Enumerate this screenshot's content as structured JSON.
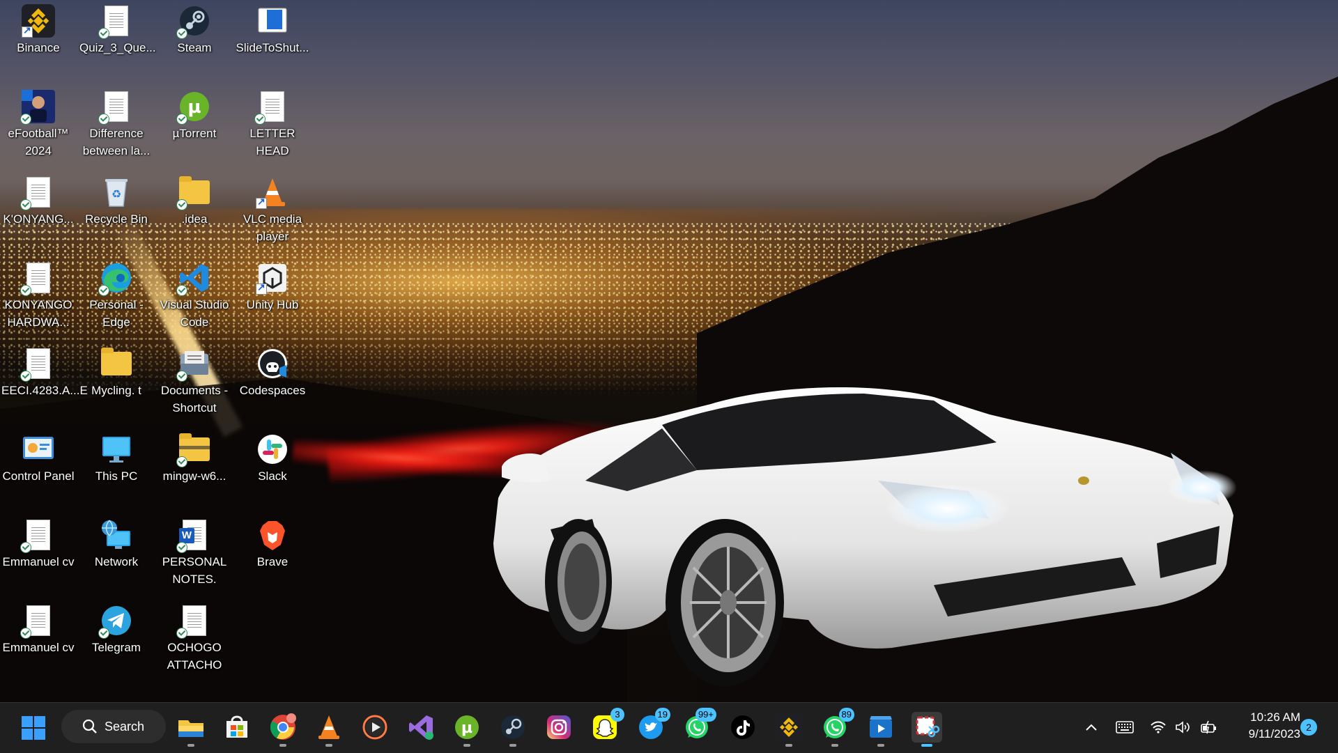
{
  "desktop": {
    "icons": [
      {
        "label": "Binance",
        "icon": "binance-icon"
      },
      {
        "label": "Quiz_3_Que...",
        "icon": "document-icon"
      },
      {
        "label": "Steam",
        "icon": "steam-icon"
      },
      {
        "label": "SlideToShut...",
        "icon": "slidetoshutdown-icon"
      },
      {
        "label": "eFootball™ 2024",
        "icon": "efootball-icon"
      },
      {
        "label": "Difference between la...",
        "icon": "document-icon"
      },
      {
        "label": "µTorrent",
        "icon": "utorrent-icon"
      },
      {
        "label": "LETTER HEAD",
        "icon": "document-icon"
      },
      {
        "label": "K'ONYANG...",
        "icon": "document-icon"
      },
      {
        "label": "Recycle Bin",
        "icon": "recycle-bin-icon"
      },
      {
        "label": ".idea",
        "icon": "folder-icon"
      },
      {
        "label": "VLC media player",
        "icon": "vlc-icon"
      },
      {
        "label": "KONYANGO HARDWA...",
        "icon": "document-icon"
      },
      {
        "label": "Personal - Edge",
        "icon": "edge-icon"
      },
      {
        "label": "Visual Studio Code",
        "icon": "vscode-icon"
      },
      {
        "label": "Unity Hub",
        "icon": "unity-hub-icon"
      },
      {
        "label": "EECI.4283.A...E",
        "icon": "document-icon"
      },
      {
        "label": "Mycling. t",
        "icon": "folder-icon"
      },
      {
        "label": "Documents - Shortcut",
        "icon": "documents-shortcut-icon"
      },
      {
        "label": "Codespaces",
        "icon": "codespaces-icon"
      },
      {
        "label": "Control Panel",
        "icon": "control-panel-icon"
      },
      {
        "label": "This PC",
        "icon": "this-pc-icon"
      },
      {
        "label": "mingw-w6...",
        "icon": "zip-folder-icon"
      },
      {
        "label": "Slack",
        "icon": "slack-icon"
      },
      {
        "label": "Emmanuel cv",
        "icon": "document-icon"
      },
      {
        "label": "Network",
        "icon": "network-icon"
      },
      {
        "label": "PERSONAL NOTES.",
        "icon": "word-document-icon"
      },
      {
        "label": "Brave",
        "icon": "brave-icon"
      },
      {
        "label": "Emmanuel cv",
        "icon": "document-icon"
      },
      {
        "label": "Telegram",
        "icon": "telegram-icon"
      },
      {
        "label": "OCHOGO ATTACHO",
        "icon": "document-icon"
      }
    ]
  },
  "taskbar": {
    "search_label": "Search",
    "pinned": [
      {
        "name": "start-button",
        "icon": "windows-logo-icon"
      },
      {
        "name": "file-explorer",
        "icon": "file-explorer-icon"
      },
      {
        "name": "microsoft-store",
        "icon": "microsoft-store-icon"
      },
      {
        "name": "chrome",
        "icon": "chrome-icon"
      },
      {
        "name": "vlc",
        "icon": "vlc-icon"
      },
      {
        "name": "media-player",
        "icon": "media-player-icon"
      },
      {
        "name": "visual-studio",
        "icon": "visual-studio-icon"
      },
      {
        "name": "utorrent",
        "icon": "utorrent-icon"
      },
      {
        "name": "steam",
        "icon": "steam-icon"
      },
      {
        "name": "instagram",
        "icon": "instagram-icon"
      },
      {
        "name": "snapchat",
        "icon": "snapchat-icon",
        "badge": "3"
      },
      {
        "name": "twitter",
        "icon": "twitter-icon",
        "badge": "19"
      },
      {
        "name": "whatsapp",
        "icon": "whatsapp-icon",
        "badge": "99+"
      },
      {
        "name": "tiktok",
        "icon": "tiktok-icon"
      },
      {
        "name": "binance",
        "icon": "binance-icon"
      },
      {
        "name": "whatsapp-business",
        "icon": "whatsapp-icon",
        "badge": "89"
      },
      {
        "name": "video-editor",
        "icon": "video-editor-icon"
      },
      {
        "name": "snipping-tool",
        "icon": "snipping-tool-icon"
      }
    ],
    "clock": {
      "time": "10:26 AM",
      "date": "9/11/2023"
    },
    "notification_count": "2"
  },
  "colors": {
    "taskbar_bg": "#1f1f1f",
    "accent": "#4cc2ff",
    "label_text": "#ffffff"
  }
}
